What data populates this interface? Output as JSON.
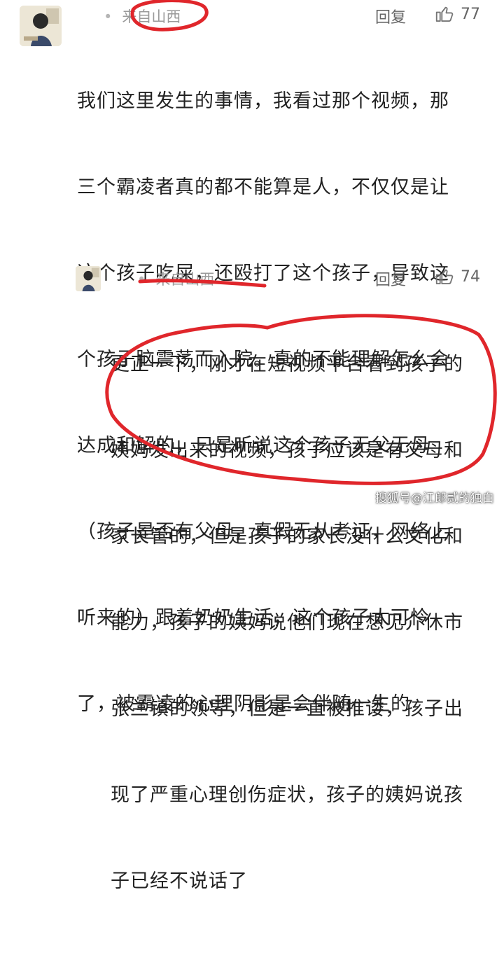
{
  "comments": [
    {
      "location": "来自山西",
      "reply_label": "回复",
      "likes": "77",
      "lines": [
        "我们这里发生的事情，我看过那个视频，那",
        "三个霸凌者真的都不能算是人，不仅仅是让",
        "这个孩子吃屎，还殴打了这个孩子，导致这",
        "个孩子脑震荡而入院。真的不能理解怎么会",
        "达成和解的，只是听说这个孩子无父无母",
        "（孩子是否有父母，真假无从考证，网络上",
        "听来的）跟着奶奶生活，这个孩子太可怜",
        "了，被霸凌的心理阴影是会伴随一生的"
      ]
    },
    {
      "location": "来自山西",
      "reply_label": "回复",
      "likes": "74",
      "lines": [
        "更正一下，刚才在短视频平台看到孩子的",
        "姨妈发出来的视频，孩子应该是有父母和",
        "家长管的，但是孩子的家长没什么文化和",
        "能力，孩子的姨妈说他们现在想见介休市",
        "张兰镇的领导，但是一直被推诿，孩子出",
        "现了严重心理创伤症状，孩子的姨妈说孩",
        "子已经不说话了"
      ]
    }
  ],
  "watermark": "搜狐号@江郎贰的独白",
  "colors": {
    "annotation": "#e0262b",
    "meta": "#9a9a9a"
  },
  "icons": [
    "avatar",
    "thumbs-up-icon"
  ]
}
